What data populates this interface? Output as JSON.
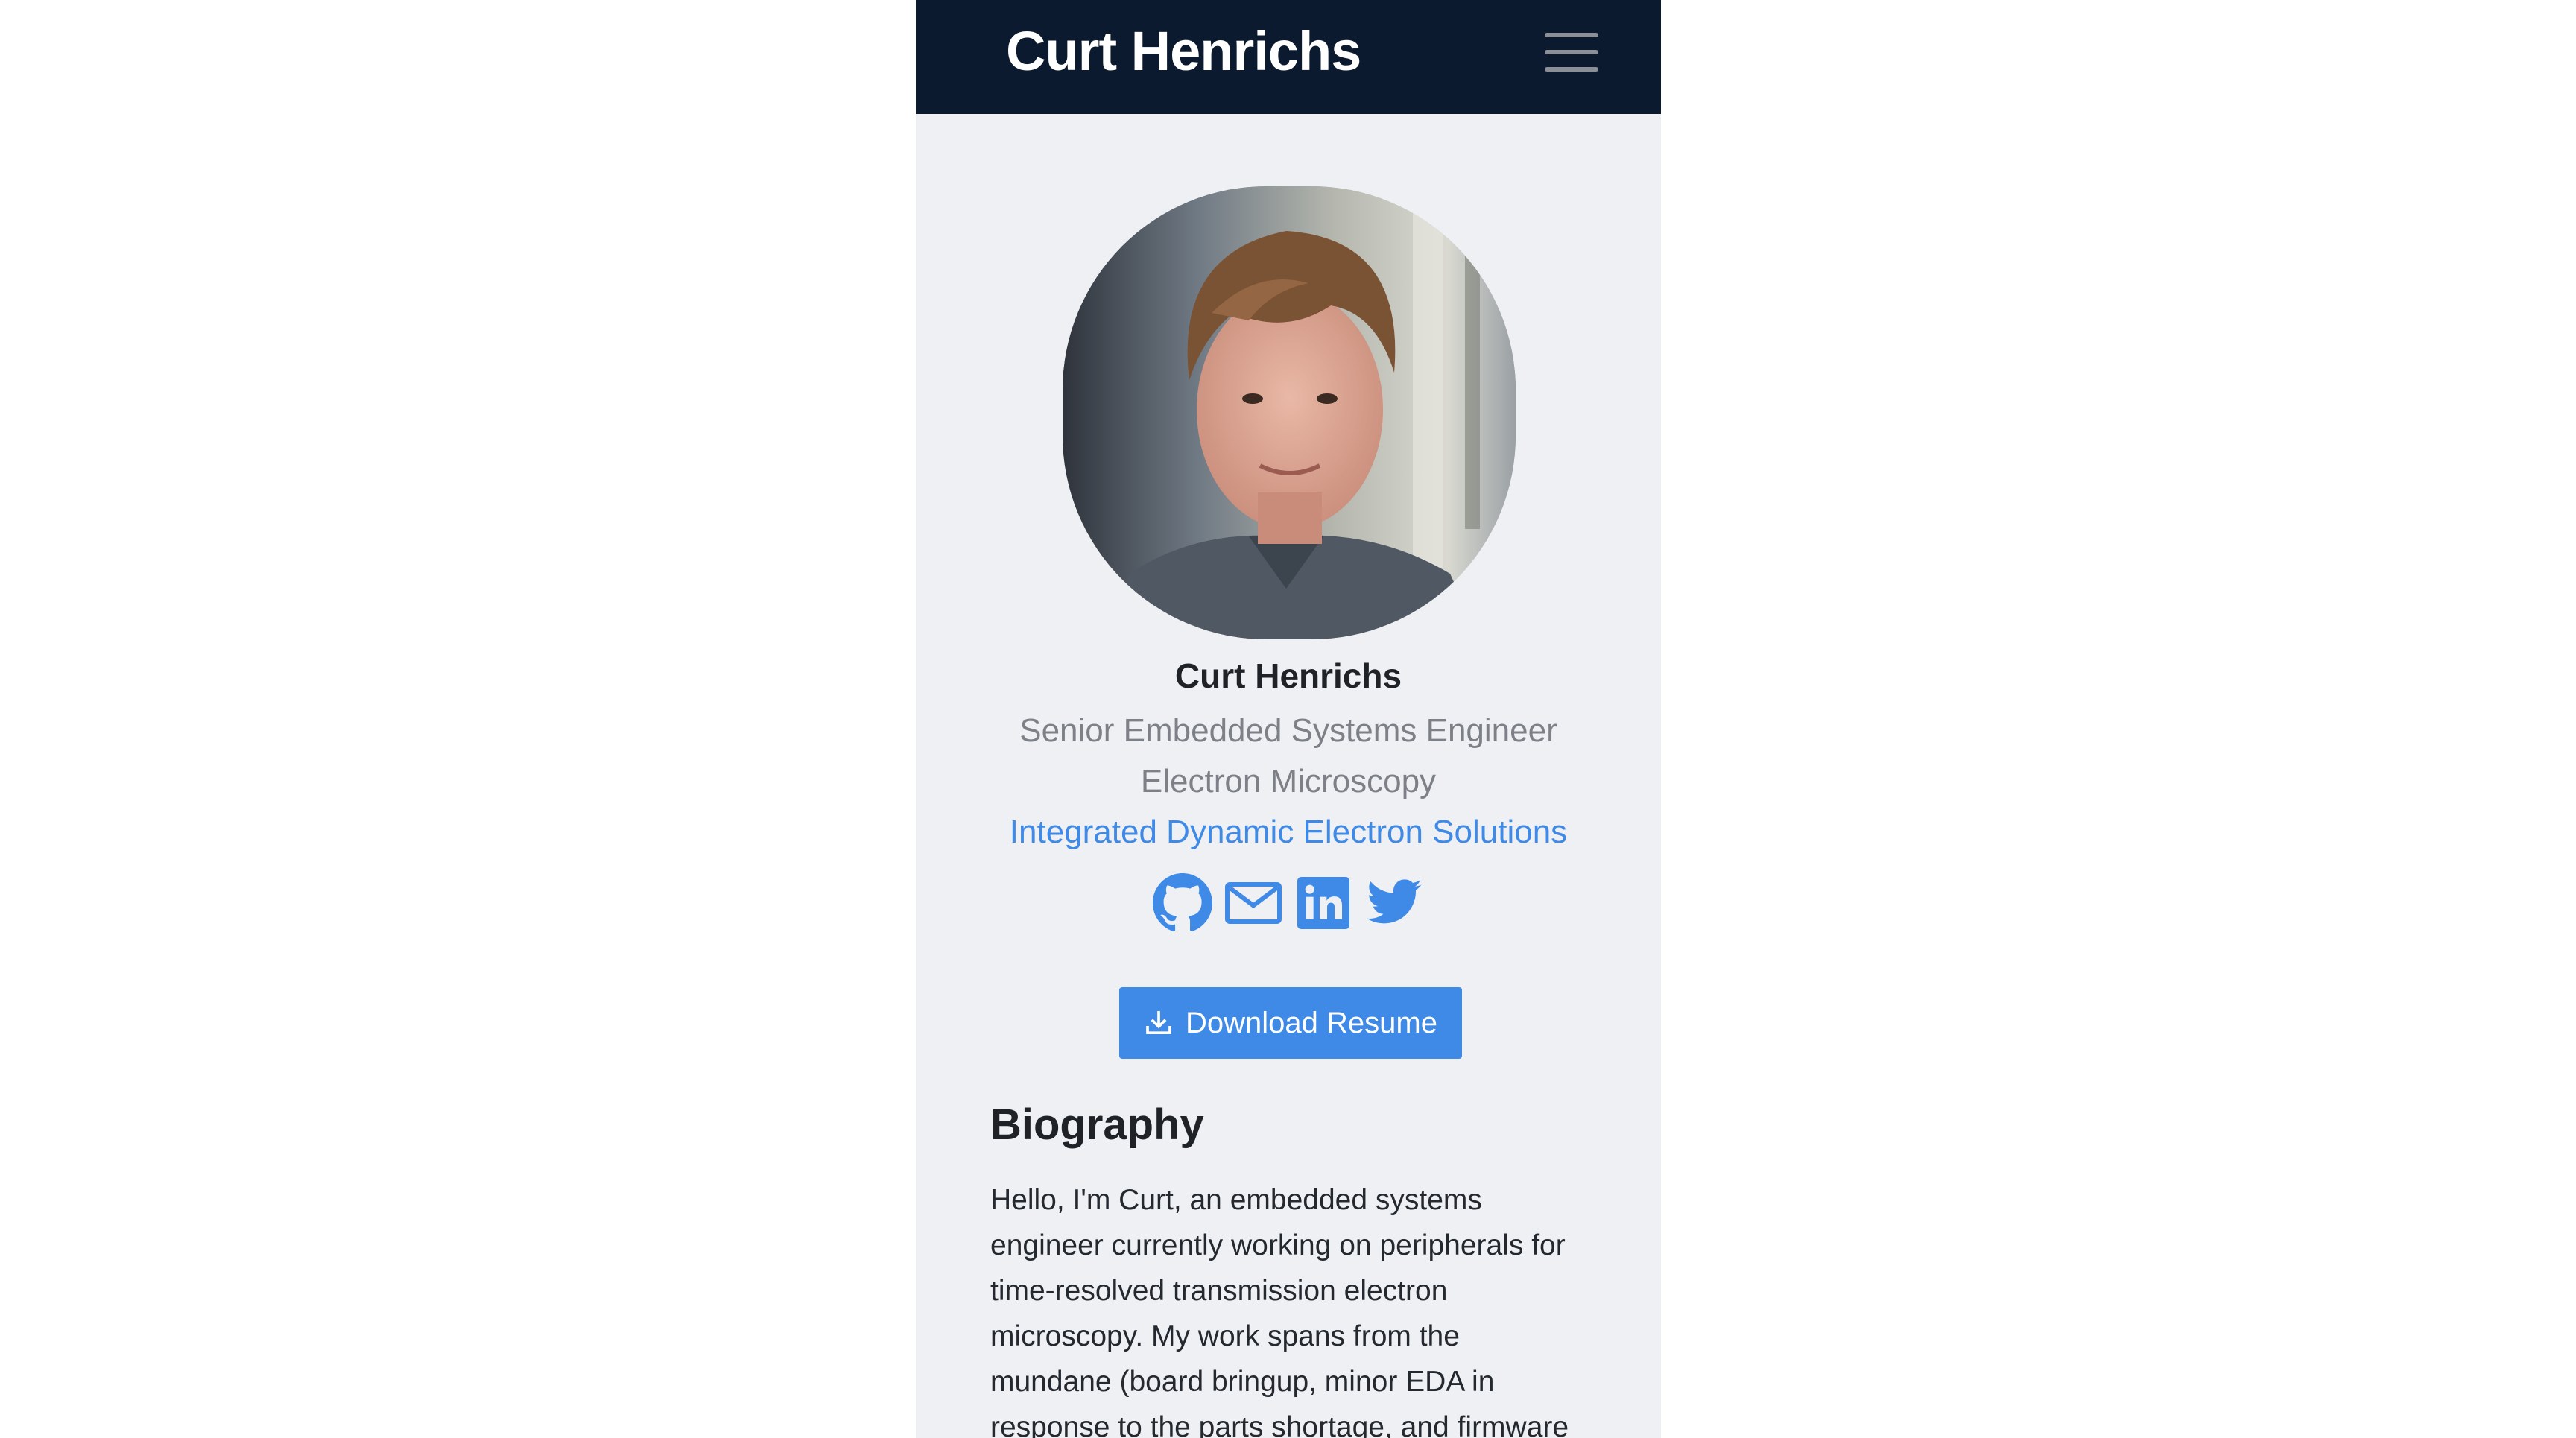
{
  "navbar": {
    "brand": "Curt Henrichs",
    "menu_icon": "hamburger-menu-icon"
  },
  "profile": {
    "avatar_alt": "",
    "name": "Curt Henrichs",
    "role": "Senior Embedded Systems Engineer",
    "department": "Electron Microscopy",
    "organization": "Integrated Dynamic Electron Solutions"
  },
  "social": [
    {
      "icon": "github-icon"
    },
    {
      "icon": "email-icon"
    },
    {
      "icon": "linkedin-icon"
    },
    {
      "icon": "twitter-icon"
    }
  ],
  "colors": {
    "navbar_bg": "#0b1a2e",
    "page_bg": "#eef0f4",
    "accent": "#3f8ae6",
    "muted_text": "#7d8187"
  },
  "resume": {
    "label": "Download Resume",
    "icon": "download-icon"
  },
  "biography": {
    "title": "Biography",
    "text": "Hello, I'm Curt, an embedded systems engineer currently working on peripherals for time-resolved transmission electron microscopy. My work spans from the mundane (board bringup, minor EDA in response to the parts shortage, and firmware"
  }
}
